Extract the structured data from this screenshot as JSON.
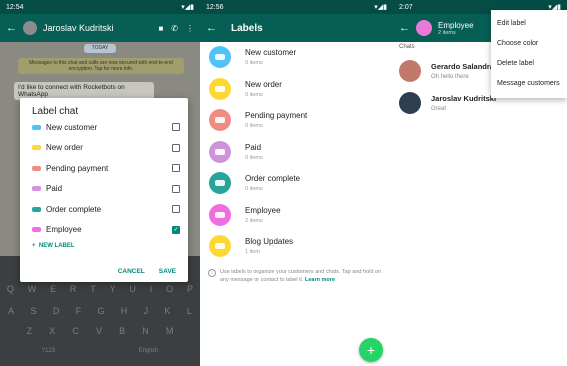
{
  "panel1": {
    "status_time": "12:54",
    "contact_name": "Jaroslav Kudritski",
    "date_pill": "TODAY",
    "encryption_note": "Messages to this chat and calls are now secured with end-to-end encryption. Tap for more info.",
    "message": "I'd like to connect with Rocketbots on WhatsApp",
    "dialog": {
      "title": "Label chat",
      "labels": [
        {
          "name": "New customer",
          "color": "#4fc3f7",
          "checked": false
        },
        {
          "name": "New order",
          "color": "#fdd835",
          "checked": false
        },
        {
          "name": "Pending payment",
          "color": "#f28b82",
          "checked": false
        },
        {
          "name": "Paid",
          "color": "#ce93d8",
          "checked": false
        },
        {
          "name": "Order complete",
          "color": "#26a69a",
          "checked": false
        },
        {
          "name": "Employee",
          "color": "#f06ee0",
          "checked": true
        }
      ],
      "new_label": "NEW LABEL",
      "cancel": "CANCEL",
      "save": "SAVE"
    },
    "keyboard_rows": [
      [
        "Q",
        "W",
        "E",
        "R",
        "T",
        "Y",
        "U",
        "I",
        "O",
        "P"
      ],
      [
        "A",
        "S",
        "D",
        "F",
        "G",
        "H",
        "J",
        "K",
        "L"
      ],
      [
        "Z",
        "X",
        "C",
        "V",
        "B",
        "N",
        "M"
      ],
      [
        "?123",
        "English"
      ]
    ]
  },
  "panel2": {
    "status_time": "12:56",
    "title": "Labels",
    "items": [
      {
        "name": "New customer",
        "count": "0 items",
        "color": "#4fc3f7"
      },
      {
        "name": "New order",
        "count": "0 items",
        "color": "#fdd835"
      },
      {
        "name": "Pending payment",
        "count": "0 items",
        "color": "#f28b82"
      },
      {
        "name": "Paid",
        "count": "0 items",
        "color": "#ce93d8"
      },
      {
        "name": "Order complete",
        "count": "0 items",
        "color": "#26a69a"
      },
      {
        "name": "Employee",
        "count": "2 items",
        "color": "#f06ee0"
      },
      {
        "name": "Blog Updates",
        "count": "1 item",
        "color": "#fdd835"
      }
    ],
    "info_text": "Use labels to organize your customers and chats. Tap and hold on any message or contact to label it.",
    "info_link": "Learn more",
    "fab": "+"
  },
  "panel3": {
    "status_time": "2:07",
    "title": "Employee",
    "subtitle": "2 items",
    "chats_header": "Chats",
    "chats": [
      {
        "name": "Gerardo Salandra",
        "sub": "Oh hello there",
        "avatar_color": "#c0796b"
      },
      {
        "name": "Jaroslav Kudritski",
        "sub": "Great",
        "avatar_color": "#2c3e50"
      }
    ],
    "menu": [
      "Edit label",
      "Choose color",
      "Delete label",
      "Message customers"
    ]
  }
}
